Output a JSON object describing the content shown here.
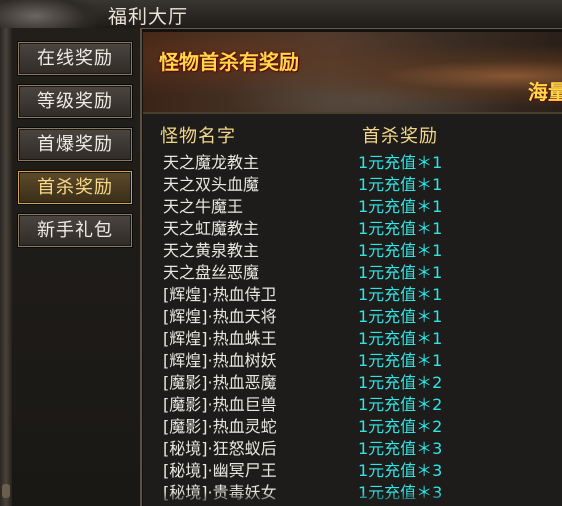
{
  "window": {
    "title": "福利大厅"
  },
  "sidebar": {
    "items": [
      {
        "label": "在线奖励",
        "active": false
      },
      {
        "label": "等级奖励",
        "active": false
      },
      {
        "label": "首爆奖励",
        "active": false
      },
      {
        "label": "首杀奖励",
        "active": true
      },
      {
        "label": "新手礼包",
        "active": false
      }
    ]
  },
  "banner": {
    "title": "怪物首杀有奖励",
    "side_text": "海量"
  },
  "table": {
    "headers": {
      "name": "怪物名字",
      "reward": "首杀奖励"
    },
    "rows": [
      {
        "name": "天之魔龙教主",
        "reward": "1元充值＊1"
      },
      {
        "name": "天之双头血魔",
        "reward": "1元充值＊1"
      },
      {
        "name": "天之牛魔王",
        "reward": "1元充值＊1"
      },
      {
        "name": "天之虹魔教主",
        "reward": "1元充值＊1"
      },
      {
        "name": "天之黄泉教主",
        "reward": "1元充值＊1"
      },
      {
        "name": "天之盘丝恶魔",
        "reward": "1元充值＊1"
      },
      {
        "name": "[辉煌]·热血侍卫",
        "reward": "1元充值＊1"
      },
      {
        "name": "[辉煌]·热血天将",
        "reward": "1元充值＊1"
      },
      {
        "name": "[辉煌]·热血蛛王",
        "reward": "1元充值＊1"
      },
      {
        "name": "[辉煌]·热血树妖",
        "reward": "1元充值＊1"
      },
      {
        "name": "[魔影]·热血恶魔",
        "reward": "1元充值＊2"
      },
      {
        "name": "[魔影]·热血巨兽",
        "reward": "1元充值＊2"
      },
      {
        "name": "[魔影]·热血灵蛇",
        "reward": "1元充值＊2"
      },
      {
        "name": "[秘境]·狂怒蚁后",
        "reward": "1元充值＊3"
      },
      {
        "name": "[秘境]·幽冥尸王",
        "reward": "1元充值＊3"
      },
      {
        "name": "[秘境]·贵毒妖女",
        "reward": "1元充值＊3"
      }
    ]
  },
  "colors": {
    "accent_gold": "#f3d78a",
    "reward_cyan": "#2ee6e6",
    "banner_text": "#ffd84a"
  }
}
